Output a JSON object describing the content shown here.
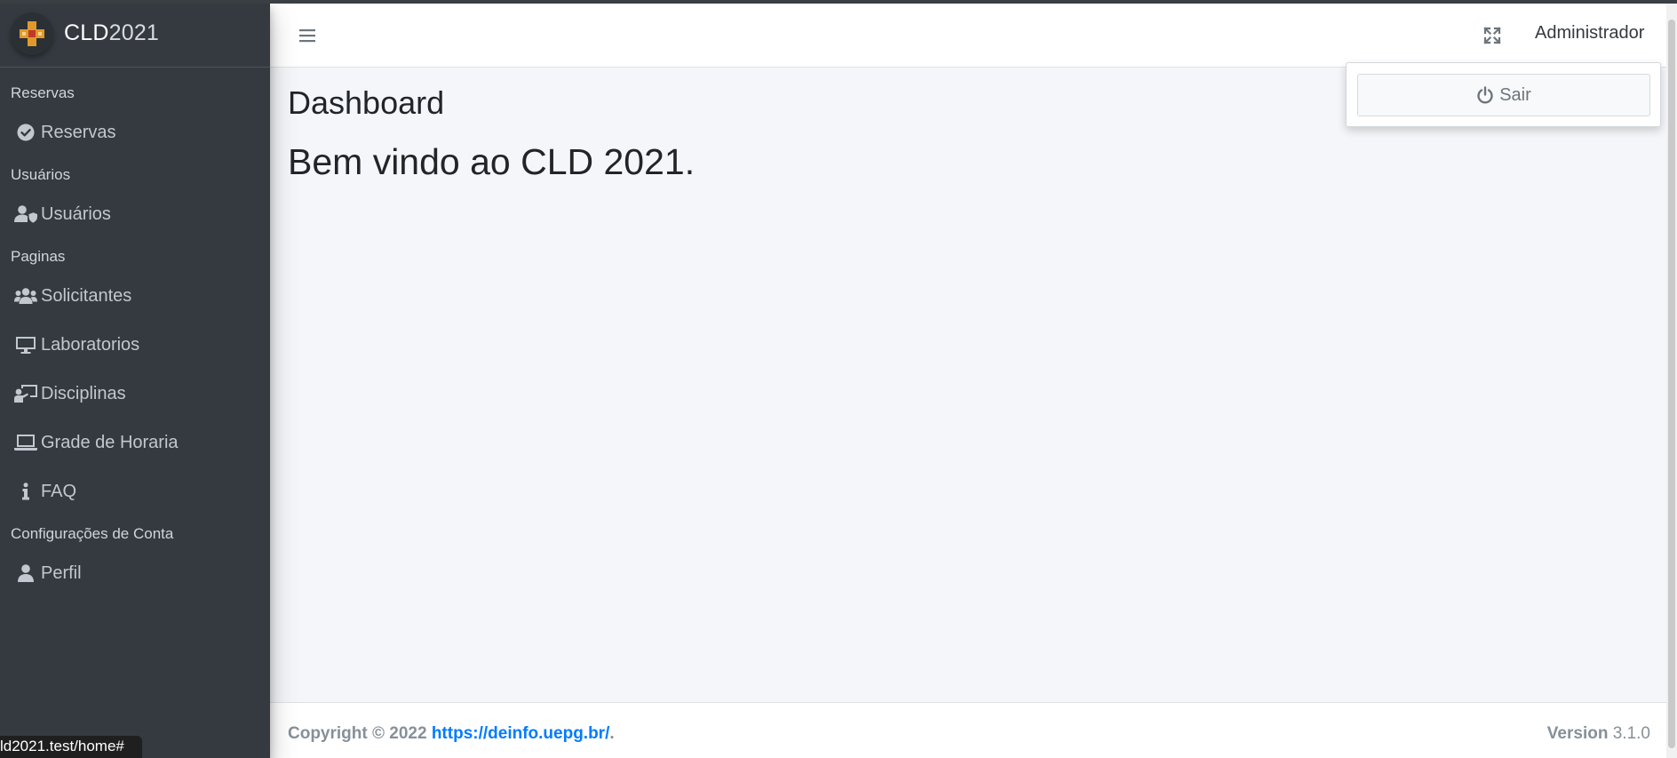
{
  "brand": {
    "name_bold": "CLD",
    "name_light": "2021"
  },
  "sidebar": {
    "sections": [
      {
        "header": "Reservas",
        "items": [
          {
            "label": "Reservas",
            "icon": "check-circle-icon"
          }
        ]
      },
      {
        "header": "Usuários",
        "items": [
          {
            "label": "Usuários",
            "icon": "user-shield-icon"
          }
        ]
      },
      {
        "header": "Paginas",
        "items": [
          {
            "label": "Solicitantes",
            "icon": "users-icon"
          },
          {
            "label": "Laboratorios",
            "icon": "desktop-icon"
          },
          {
            "label": "Disciplinas",
            "icon": "chalkboard-teacher-icon"
          },
          {
            "label": "Grade de Horaria",
            "icon": "laptop-icon"
          },
          {
            "label": "FAQ",
            "icon": "info-icon"
          }
        ]
      },
      {
        "header": "Configurações de Conta",
        "items": [
          {
            "label": "Perfil",
            "icon": "user-icon"
          }
        ]
      }
    ]
  },
  "navbar": {
    "menu_icon": "hamburger-icon",
    "fullscreen_icon": "expand-icon",
    "user_name": "Administrador"
  },
  "dropdown": {
    "logout_label": "Sair",
    "logout_icon": "power-icon"
  },
  "content": {
    "title": "Dashboard",
    "welcome": "Bem vindo ao CLD 2021."
  },
  "footer": {
    "copyright_prefix": "Copyright © 2022 ",
    "link_text": "https://deinfo.uepg.br/",
    "link_suffix": ".",
    "version_label": "Version",
    "version_value": " 3.1.0"
  },
  "status_bar": {
    "url": "ld2021.test/home#"
  },
  "colors": {
    "sidebar_bg": "#343a40",
    "sidebar_text": "#c2c7d0",
    "content_bg": "#f4f6f9",
    "link": "#007bff"
  }
}
